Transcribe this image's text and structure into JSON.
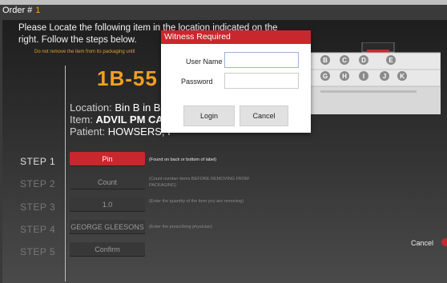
{
  "header": {
    "order_label": "Order #",
    "order_number": "1"
  },
  "instructions": {
    "text": "Please Locate the following item in the location indicated on the right. Follow the steps below.",
    "warning": "Do not remove the item from its packaging until"
  },
  "item": {
    "location_code": "1B-55",
    "location_label": "Location:",
    "location_value": "Bin B in BIN",
    "item_label": "Item:",
    "item_value": "ADVIL PM CAP",
    "patient_label": "Patient:",
    "patient_value": "HOWSERS, I"
  },
  "steps": [
    {
      "label": "STEP 1",
      "button": "Pin",
      "hint": "(Found on back or bottom of label)",
      "active": true
    },
    {
      "label": "STEP 2",
      "button": "Count",
      "hint": "(Count number items BEFORE REMOVING FROM PACKAGING)",
      "active": false
    },
    {
      "label": "STEP 3",
      "button": "1.0",
      "hint": "(Enter the quantity of the item you are removing)",
      "active": false
    },
    {
      "label": "STEP 4",
      "button": "GEORGE GLEESONS",
      "hint": "(Enter the prescribing physician)",
      "active": false
    },
    {
      "label": "STEP 5",
      "button": "Confirm",
      "hint": "",
      "active": false
    }
  ],
  "footer": {
    "cancel_label": "Cancel"
  },
  "bins": {
    "row1": [
      "B",
      "C",
      "D",
      "E"
    ],
    "row2": [
      "G",
      "H",
      "I",
      "J",
      "K"
    ]
  },
  "colors": {
    "accent": "#c8282d",
    "highlight": "#f0a020"
  },
  "modal": {
    "title": "Witness Required",
    "username_label": "User Name",
    "username_value": "",
    "password_label": "Password",
    "password_value": "",
    "login_label": "Login",
    "cancel_label": "Cancel"
  }
}
